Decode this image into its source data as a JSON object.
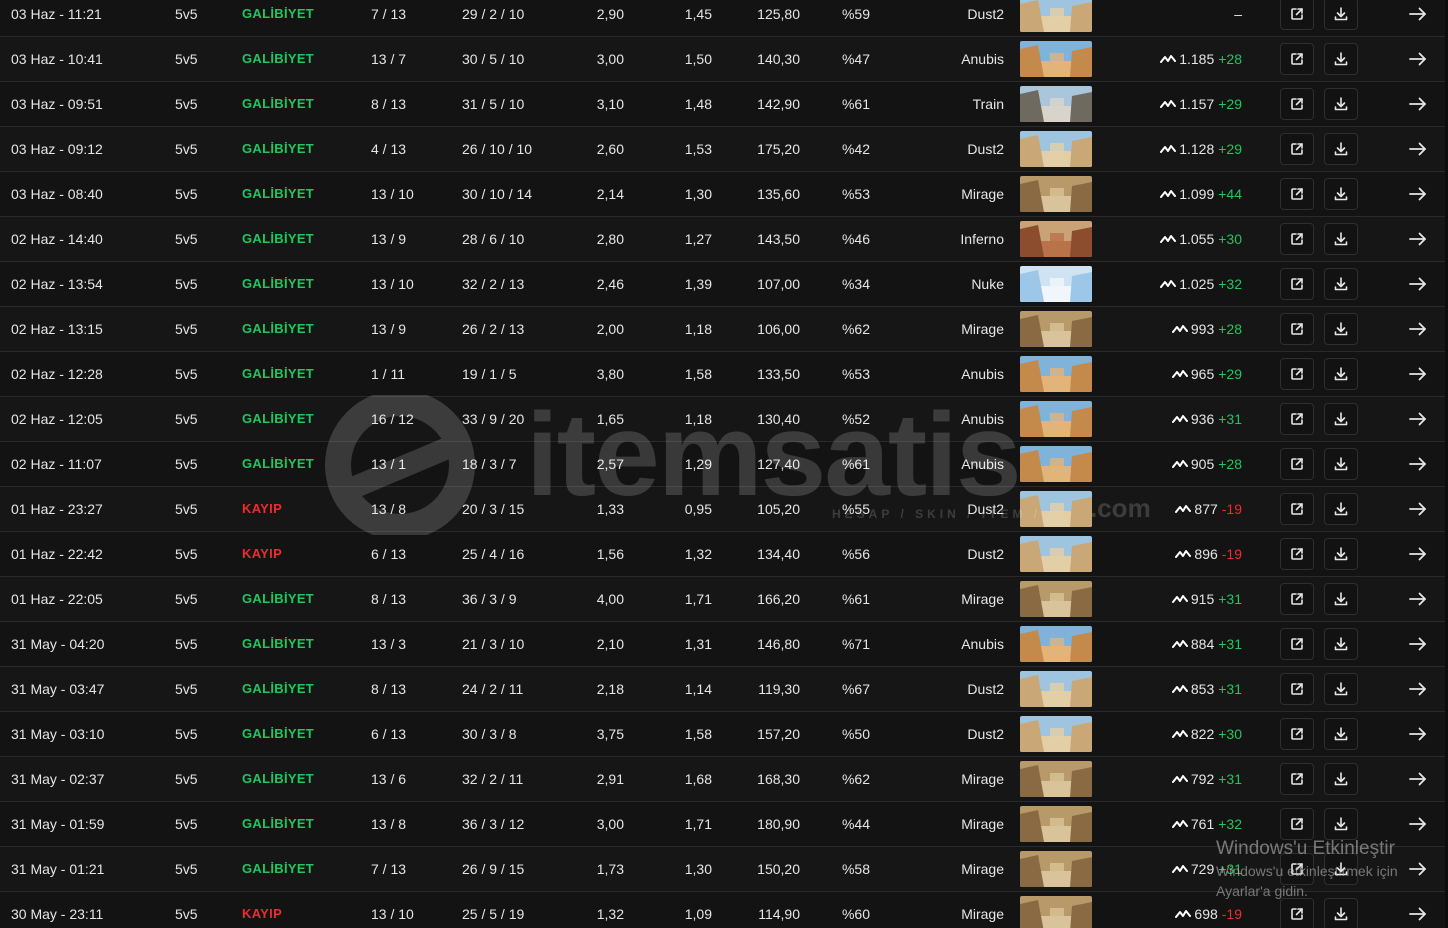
{
  "colors": {
    "win": "#22c55e",
    "loss": "#ef2b2b",
    "row_bg": "#161616",
    "border": "#2a2a2a"
  },
  "row_icons": {
    "elo": "elo-trend-icon",
    "open": "external-link-icon",
    "download": "download-icon",
    "go": "arrow-right-icon"
  },
  "matches": [
    {
      "date": "03 Haz - 11:21",
      "mode": "5v5",
      "result": "GALİBİYET",
      "win": true,
      "score": "7 / 13",
      "kda": "29 / 2 / 10",
      "kd": "2,90",
      "kr": "1,45",
      "adr": "125,80",
      "hs": "%59",
      "map": "Dust2",
      "elo": "",
      "delta": "–"
    },
    {
      "date": "03 Haz - 10:41",
      "mode": "5v5",
      "result": "GALİBİYET",
      "win": true,
      "score": "13 / 7",
      "kda": "30 / 5 / 10",
      "kd": "3,00",
      "kr": "1,50",
      "adr": "140,30",
      "hs": "%47",
      "map": "Anubis",
      "elo": "1.185",
      "delta": "+28"
    },
    {
      "date": "03 Haz - 09:51",
      "mode": "5v5",
      "result": "GALİBİYET",
      "win": true,
      "score": "8 / 13",
      "kda": "31 / 5 / 10",
      "kd": "3,10",
      "kr": "1,48",
      "adr": "142,90",
      "hs": "%61",
      "map": "Train",
      "elo": "1.157",
      "delta": "+29"
    },
    {
      "date": "03 Haz - 09:12",
      "mode": "5v5",
      "result": "GALİBİYET",
      "win": true,
      "score": "4 / 13",
      "kda": "26 / 10 / 10",
      "kd": "2,60",
      "kr": "1,53",
      "adr": "175,20",
      "hs": "%42",
      "map": "Dust2",
      "elo": "1.128",
      "delta": "+29"
    },
    {
      "date": "03 Haz - 08:40",
      "mode": "5v5",
      "result": "GALİBİYET",
      "win": true,
      "score": "13 / 10",
      "kda": "30 / 10 / 14",
      "kd": "2,14",
      "kr": "1,30",
      "adr": "135,60",
      "hs": "%53",
      "map": "Mirage",
      "elo": "1.099",
      "delta": "+44"
    },
    {
      "date": "02 Haz - 14:40",
      "mode": "5v5",
      "result": "GALİBİYET",
      "win": true,
      "score": "13 / 9",
      "kda": "28 / 6 / 10",
      "kd": "2,80",
      "kr": "1,27",
      "adr": "143,50",
      "hs": "%46",
      "map": "Inferno",
      "elo": "1.055",
      "delta": "+30"
    },
    {
      "date": "02 Haz - 13:54",
      "mode": "5v5",
      "result": "GALİBİYET",
      "win": true,
      "score": "13 / 10",
      "kda": "32 / 2 / 13",
      "kd": "2,46",
      "kr": "1,39",
      "adr": "107,00",
      "hs": "%34",
      "map": "Nuke",
      "elo": "1.025",
      "delta": "+32"
    },
    {
      "date": "02 Haz - 13:15",
      "mode": "5v5",
      "result": "GALİBİYET",
      "win": true,
      "score": "13 / 9",
      "kda": "26 / 2 / 13",
      "kd": "2,00",
      "kr": "1,18",
      "adr": "106,00",
      "hs": "%62",
      "map": "Mirage",
      "elo": "993",
      "delta": "+28"
    },
    {
      "date": "02 Haz - 12:28",
      "mode": "5v5",
      "result": "GALİBİYET",
      "win": true,
      "score": "1 / 11",
      "kda": "19 / 1 / 5",
      "kd": "3,80",
      "kr": "1,58",
      "adr": "133,50",
      "hs": "%53",
      "map": "Anubis",
      "elo": "965",
      "delta": "+29"
    },
    {
      "date": "02 Haz - 12:05",
      "mode": "5v5",
      "result": "GALİBİYET",
      "win": true,
      "score": "16 / 12",
      "kda": "33 / 9 / 20",
      "kd": "1,65",
      "kr": "1,18",
      "adr": "130,40",
      "hs": "%52",
      "map": "Anubis",
      "elo": "936",
      "delta": "+31"
    },
    {
      "date": "02 Haz - 11:07",
      "mode": "5v5",
      "result": "GALİBİYET",
      "win": true,
      "score": "13 / 1",
      "kda": "18 / 3 / 7",
      "kd": "2,57",
      "kr": "1,29",
      "adr": "127,40",
      "hs": "%61",
      "map": "Anubis",
      "elo": "905",
      "delta": "+28"
    },
    {
      "date": "01 Haz - 23:27",
      "mode": "5v5",
      "result": "KAYIP",
      "win": false,
      "score": "13 / 8",
      "kda": "20 / 3 / 15",
      "kd": "1,33",
      "kr": "0,95",
      "adr": "105,20",
      "hs": "%55",
      "map": "Dust2",
      "elo": "877",
      "delta": "-19"
    },
    {
      "date": "01 Haz - 22:42",
      "mode": "5v5",
      "result": "KAYIP",
      "win": false,
      "score": "6 / 13",
      "kda": "25 / 4 / 16",
      "kd": "1,56",
      "kr": "1,32",
      "adr": "134,40",
      "hs": "%56",
      "map": "Dust2",
      "elo": "896",
      "delta": "-19"
    },
    {
      "date": "01 Haz - 22:05",
      "mode": "5v5",
      "result": "GALİBİYET",
      "win": true,
      "score": "8 / 13",
      "kda": "36 / 3 / 9",
      "kd": "4,00",
      "kr": "1,71",
      "adr": "166,20",
      "hs": "%61",
      "map": "Mirage",
      "elo": "915",
      "delta": "+31"
    },
    {
      "date": "31 May - 04:20",
      "mode": "5v5",
      "result": "GALİBİYET",
      "win": true,
      "score": "13 / 3",
      "kda": "21 / 3 / 10",
      "kd": "2,10",
      "kr": "1,31",
      "adr": "146,80",
      "hs": "%71",
      "map": "Anubis",
      "elo": "884",
      "delta": "+31"
    },
    {
      "date": "31 May - 03:47",
      "mode": "5v5",
      "result": "GALİBİYET",
      "win": true,
      "score": "8 / 13",
      "kda": "24 / 2 / 11",
      "kd": "2,18",
      "kr": "1,14",
      "adr": "119,30",
      "hs": "%67",
      "map": "Dust2",
      "elo": "853",
      "delta": "+31"
    },
    {
      "date": "31 May - 03:10",
      "mode": "5v5",
      "result": "GALİBİYET",
      "win": true,
      "score": "6 / 13",
      "kda": "30 / 3 / 8",
      "kd": "3,75",
      "kr": "1,58",
      "adr": "157,20",
      "hs": "%50",
      "map": "Dust2",
      "elo": "822",
      "delta": "+30"
    },
    {
      "date": "31 May - 02:37",
      "mode": "5v5",
      "result": "GALİBİYET",
      "win": true,
      "score": "13 / 6",
      "kda": "32 / 2 / 11",
      "kd": "2,91",
      "kr": "1,68",
      "adr": "168,30",
      "hs": "%62",
      "map": "Mirage",
      "elo": "792",
      "delta": "+31"
    },
    {
      "date": "31 May - 01:59",
      "mode": "5v5",
      "result": "GALİBİYET",
      "win": true,
      "score": "13 / 8",
      "kda": "36 / 3 / 12",
      "kd": "3,00",
      "kr": "1,71",
      "adr": "180,90",
      "hs": "%44",
      "map": "Mirage",
      "elo": "761",
      "delta": "+32"
    },
    {
      "date": "31 May - 01:21",
      "mode": "5v5",
      "result": "GALİBİYET",
      "win": true,
      "score": "7 / 13",
      "kda": "26 / 9 / 15",
      "kd": "1,73",
      "kr": "1,30",
      "adr": "150,20",
      "hs": "%58",
      "map": "Mirage",
      "elo": "729",
      "delta": "+31"
    },
    {
      "date": "30 May - 23:11",
      "mode": "5v5",
      "result": "KAYIP",
      "win": false,
      "score": "13 / 10",
      "kda": "25 / 5 / 19",
      "kd": "1,32",
      "kr": "1,09",
      "adr": "114,90",
      "hs": "%60",
      "map": "Mirage",
      "elo": "698",
      "delta": "-19"
    }
  ],
  "watermark": {
    "brand": "itemsatis",
    "tagline": "HESAP / SKIN / ITEM /",
    "domain": ".com"
  },
  "windows_activation": {
    "title": "Windows'u Etkinleştir",
    "subtitle": "Windows'u etkinleştirmek için Ayarlar'a gidin."
  }
}
